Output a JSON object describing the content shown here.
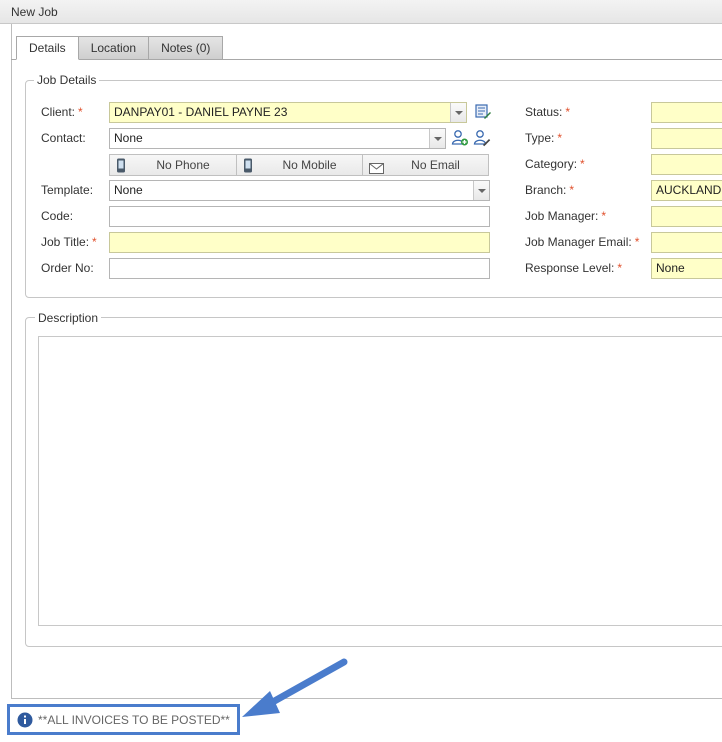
{
  "window": {
    "title": "New Job"
  },
  "tabs": [
    {
      "label": "Details",
      "active": true
    },
    {
      "label": "Location",
      "active": false
    },
    {
      "label": "Notes (0)",
      "active": false
    }
  ],
  "job_details": {
    "legend": "Job Details",
    "client": {
      "label": "Client:",
      "required": "*",
      "value": "DANPAY01 - DANIEL PAYNE 23"
    },
    "contact": {
      "label": "Contact:",
      "value": "None"
    },
    "contact_buttons": {
      "phone": "No Phone",
      "mobile": "No Mobile",
      "email": "No Email"
    },
    "template": {
      "label": "Template:",
      "value": "None"
    },
    "code": {
      "label": "Code:",
      "value": ""
    },
    "job_title": {
      "label": "Job Title:",
      "required": "*",
      "value": ""
    },
    "order_no": {
      "label": "Order No:",
      "value": ""
    },
    "status": {
      "label": "Status:",
      "required": "*",
      "value": ""
    },
    "type": {
      "label": "Type:",
      "required": "*",
      "value": ""
    },
    "category": {
      "label": "Category:",
      "required": "*",
      "value": ""
    },
    "branch": {
      "label": "Branch:",
      "required": "*",
      "value": "AUCKLAND"
    },
    "job_manager": {
      "label": "Job Manager:",
      "required": "*",
      "value": ""
    },
    "job_manager_email": {
      "label": "Job Manager Email:",
      "required": "*",
      "value": ""
    },
    "response_level": {
      "label": "Response Level:",
      "required": "*",
      "value": "None"
    }
  },
  "description": {
    "legend": "Description",
    "value": ""
  },
  "notice": {
    "text": "**ALL INVOICES TO BE POSTED**"
  },
  "colors": {
    "required": "#e0502c",
    "required_field_bg": "#ffffc8",
    "annotation": "#4a7ccc"
  },
  "icons": [
    "client-lookup-icon",
    "add-contact-icon",
    "edit-contact-icon",
    "phone-icon",
    "mobile-icon",
    "email-icon",
    "info-icon",
    "annotation-arrow"
  ]
}
